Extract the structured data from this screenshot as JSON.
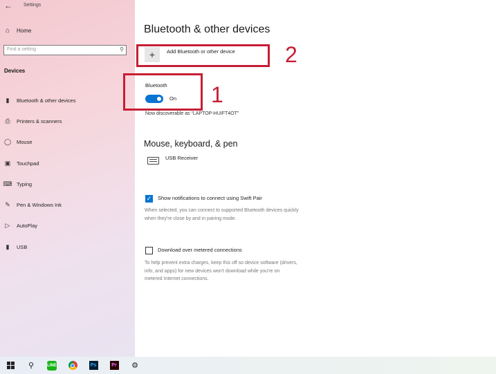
{
  "titlebar": {
    "back_icon": "arrow-left-icon",
    "title": "Settings"
  },
  "sidebar": {
    "home_label": "Home",
    "search": {
      "placeholder": "Find a setting"
    },
    "section_label": "Devices",
    "items": [
      {
        "label": "Bluetooth & other devices",
        "icon": "bluetooth-icon"
      },
      {
        "label": "Printers & scanners",
        "icon": "printer-icon"
      },
      {
        "label": "Mouse",
        "icon": "mouse-icon"
      },
      {
        "label": "Touchpad",
        "icon": "touchpad-icon"
      },
      {
        "label": "Typing",
        "icon": "keyboard-icon"
      },
      {
        "label": "Pen & Windows Ink",
        "icon": "pen-icon"
      },
      {
        "label": "AutoPlay",
        "icon": "autoplay-icon"
      },
      {
        "label": "USB",
        "icon": "usb-icon"
      }
    ]
  },
  "main": {
    "title": "Bluetooth & other devices",
    "add_device_label": "Add Bluetooth or other device",
    "bluetooth": {
      "label": "Bluetooth",
      "state": "On",
      "enabled": true
    },
    "discoverable_text": "Now discoverable as “LAPTOP-HUIFT4OT”",
    "devices_heading": "Mouse, keyboard, & pen",
    "devices": [
      {
        "name": "USB Receiver",
        "icon": "keyboard-icon"
      }
    ],
    "swift_pair": {
      "checked": true,
      "label": "Show notifications to connect using Swift Pair",
      "desc_line1": "When selected, you can connect to supported Bluetooth devices quickly",
      "desc_line2": "when they're close by and in pairing mode."
    },
    "metered": {
      "checked": false,
      "label": "Download over metered connections",
      "desc_line1": "To help prevent extra charges, keep this off so device software (drivers,",
      "desc_line2": "info, and apps) for new devices won't download while you're on",
      "desc_line3": "metered Internet connections."
    }
  },
  "annotations": {
    "number_1": "1",
    "number_2": "2",
    "color": "#c61e34"
  },
  "taskbar": {
    "items": [
      "windows-start-icon",
      "search-icon",
      "line-app-icon",
      "chrome-icon",
      "photoshop-icon",
      "premiere-icon",
      "settings-gear-icon"
    ],
    "line_text": "LINE",
    "ps_text": "Ps",
    "pr_text": "Pr"
  },
  "colors": {
    "accent": "#0a74d2",
    "annotation": "#c61e34"
  }
}
